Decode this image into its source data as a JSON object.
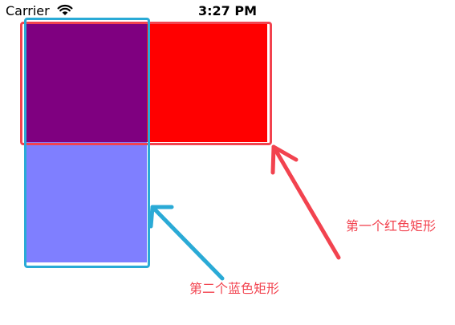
{
  "status_bar": {
    "carrier": "Carrier",
    "time": "3:27 PM",
    "wifi_icon": "wifi-icon"
  },
  "colors": {
    "red_rect": "#ff0000",
    "blue_rect": "#0000ff",
    "overlap": "#800080",
    "red_annotation": "#f2434f",
    "blue_annotation": "#2aaad6"
  },
  "annotations": {
    "red_label": "第一个红色矩形",
    "blue_label": "第二个蓝色矩形"
  }
}
